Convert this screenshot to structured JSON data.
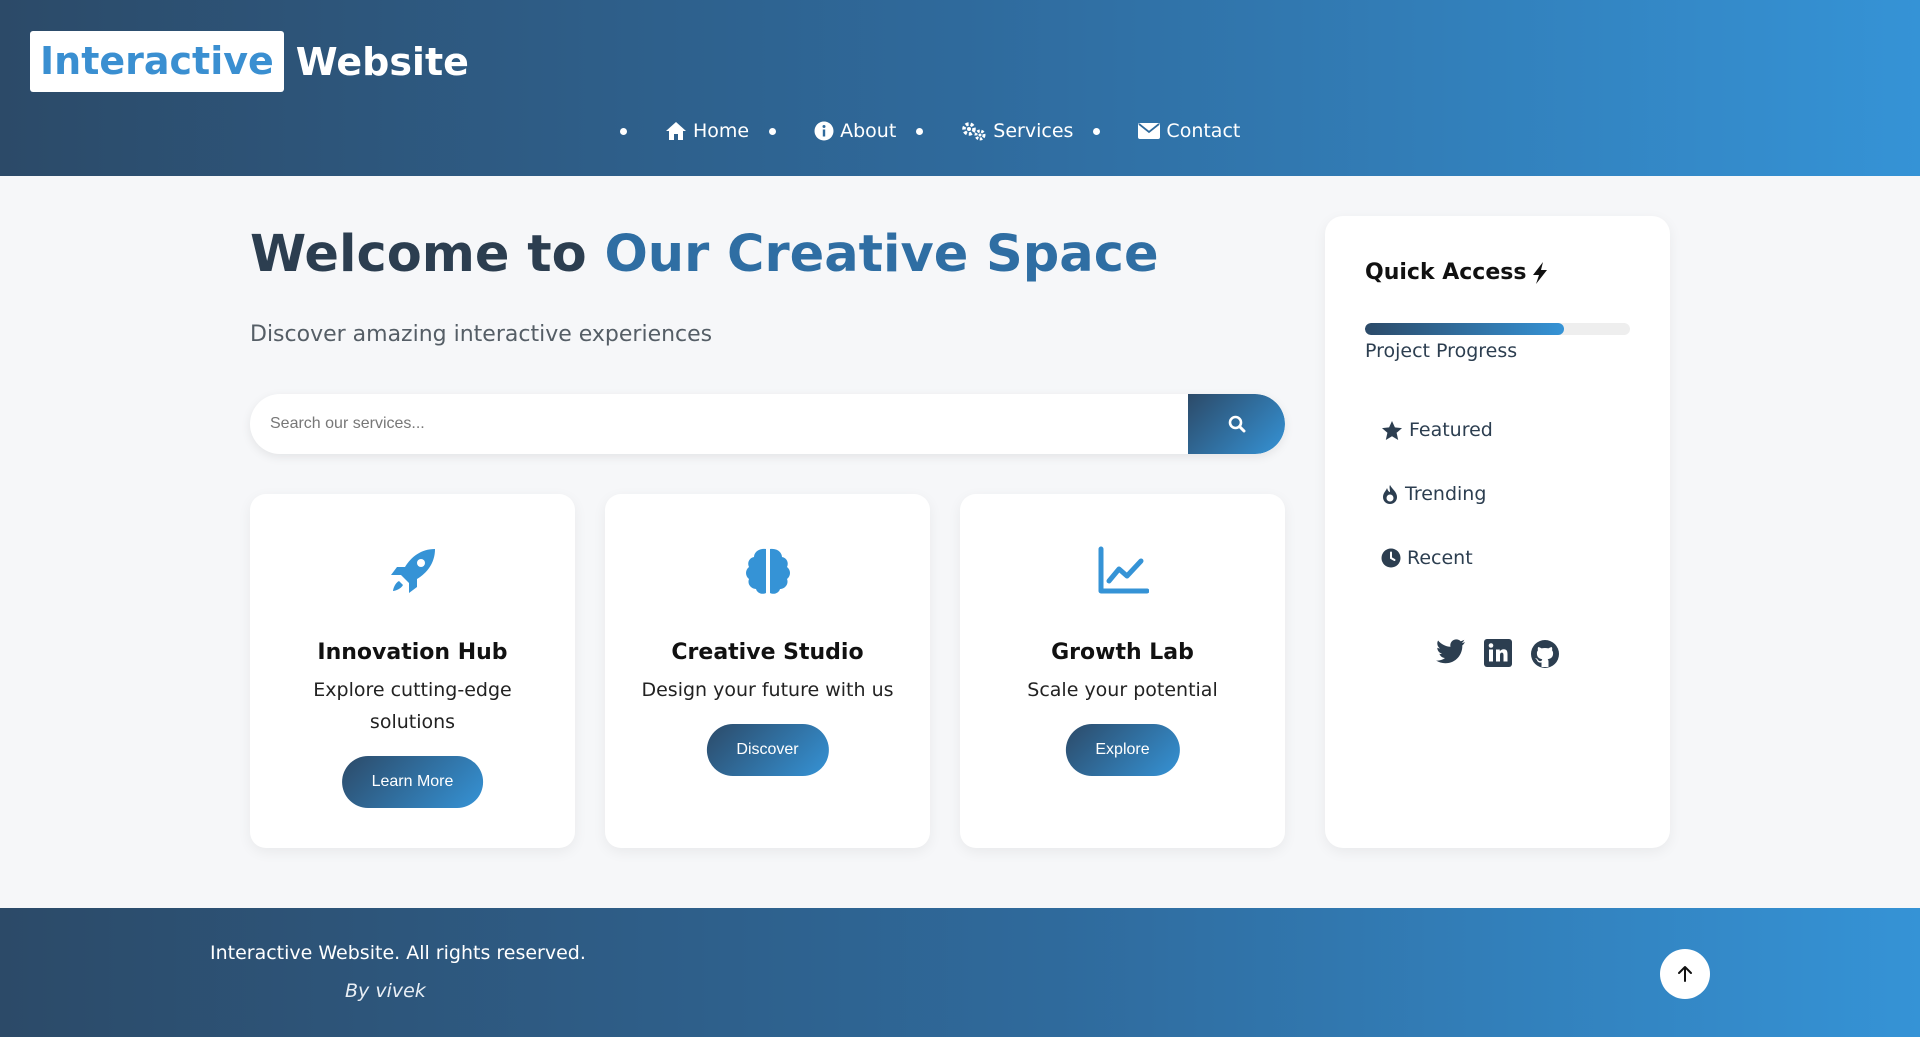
{
  "header": {
    "logo_highlight": "Interactive",
    "logo_rest": "Website",
    "nav": [
      {
        "label": "Home",
        "icon": "home-icon"
      },
      {
        "label": "About",
        "icon": "info-icon"
      },
      {
        "label": "Services",
        "icon": "gears-icon"
      },
      {
        "label": "Contact",
        "icon": "envelope-icon"
      }
    ]
  },
  "main": {
    "title_dark": "Welcome to",
    "title_accent": "Our Creative Space",
    "subtitle": "Discover amazing interactive experiences",
    "search_placeholder": "Search our services...",
    "cards": [
      {
        "icon": "rocket-icon",
        "title": "Innovation Hub",
        "description": "Explore cutting-edge solutions",
        "button": "Learn More"
      },
      {
        "icon": "brain-icon",
        "title": "Creative Studio",
        "description": "Design your future with us",
        "button": "Discover"
      },
      {
        "icon": "chart-line-icon",
        "title": "Growth Lab",
        "description": "Scale your potential",
        "button": "Explore"
      }
    ]
  },
  "sidebar": {
    "title": "Quick Access",
    "progress_label": "Project Progress",
    "progress_fraction": 0.75,
    "links": [
      {
        "label": "Featured",
        "icon": "star-icon"
      },
      {
        "label": "Trending",
        "icon": "fire-icon"
      },
      {
        "label": "Recent",
        "icon": "clock-icon"
      }
    ],
    "socials": [
      "twitter-icon",
      "linkedin-icon",
      "github-icon"
    ]
  },
  "footer": {
    "copyright": "Interactive Website. All rights reserved.",
    "byline": "By vivek"
  },
  "colors": {
    "accent": "#3593d6",
    "dark": "#2c4a68",
    "text": "#2c3e50"
  }
}
